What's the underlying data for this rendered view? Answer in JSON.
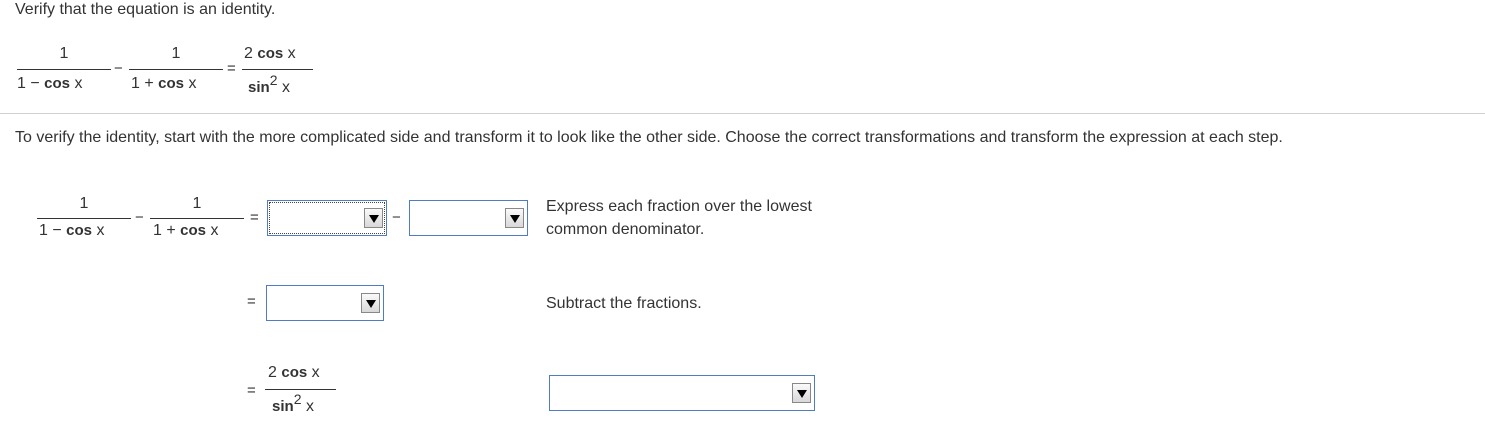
{
  "header": {
    "instruction": "Verify that the equation is an identity."
  },
  "equation": {
    "term1": {
      "numerator": "1",
      "den_prefix": "1 −",
      "den_func": "cos",
      "den_var": "x"
    },
    "minus": "−",
    "term2": {
      "numerator": "1",
      "den_prefix": "1 +",
      "den_func": "cos",
      "den_var": "x"
    },
    "equals": "=",
    "rhs": {
      "num_coef": "2",
      "num_func": "cos",
      "num_var": "x",
      "den_func": "sin",
      "den_exp": "2",
      "den_var": "x"
    }
  },
  "explanation": "To verify the identity, start with the more complicated side and transform it to look like the other side. Choose the correct transformations and transform the expression at each step.",
  "steps": [
    {
      "hint": "Express each fraction over the lowest common denominator.",
      "dropdown_a": "",
      "dropdown_b": ""
    },
    {
      "hint": "Subtract the fractions.",
      "dropdown": ""
    },
    {
      "hint": "",
      "dropdown": ""
    }
  ],
  "colors": {
    "dropdown_border": "#4f7dc0",
    "divider": "#d0d0d0",
    "text": "#333333"
  }
}
